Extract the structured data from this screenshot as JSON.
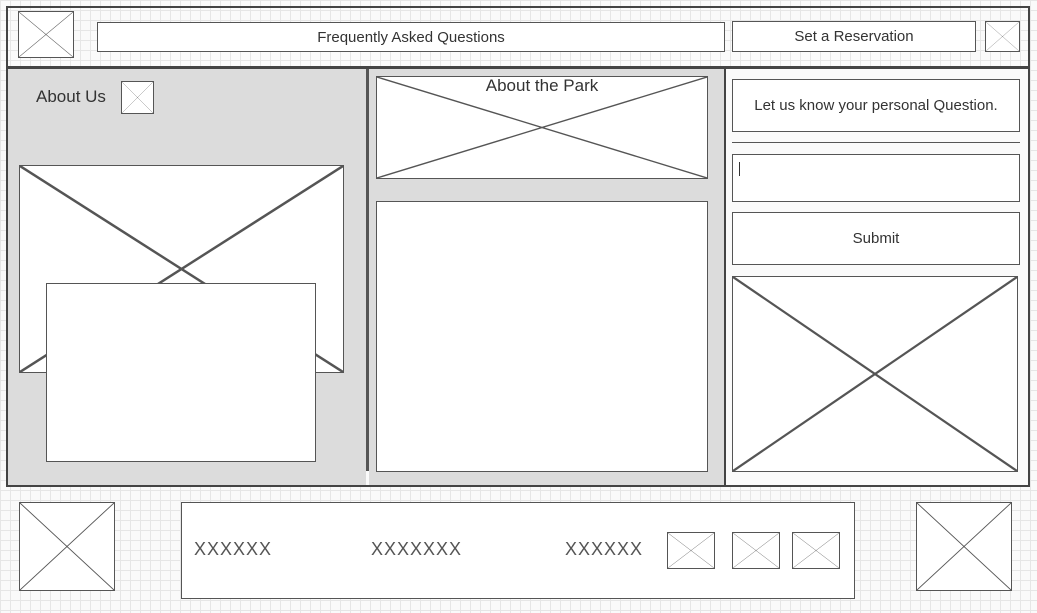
{
  "header": {
    "faq_label": "Frequently Asked Questions",
    "reservation_label": "Set a Reservation"
  },
  "about_us": {
    "title": "About Us"
  },
  "about_park": {
    "title": "About the Park"
  },
  "question_form": {
    "prompt": "Let us know your personal Question.",
    "input_value": "",
    "submit_label": "Submit"
  },
  "footer": {
    "nav_items": [
      "XXXXXX",
      "XXXXXXX",
      "XXXXXX"
    ]
  },
  "icons": {
    "placeholder": "image-placeholder-icon"
  }
}
